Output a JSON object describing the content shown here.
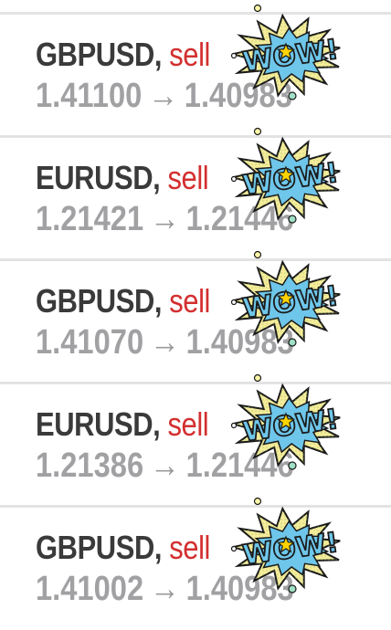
{
  "colors": {
    "pair_text": "#3a3a3a",
    "sell_red": "#d32f2f",
    "price_grey": "#a1a1a4",
    "divider": "#e3e3e3",
    "sticker_yellow": "#f5ec9a",
    "sticker_blue": "#6ec6ea",
    "sticker_star": "#ffd400"
  },
  "sticker": {
    "text": "WOW!",
    "icon": "wow-comic-sticker"
  },
  "trades": [
    {
      "pair": "GBPUSD",
      "separator": ", ",
      "direction": "sell",
      "entry_price": "1.41100",
      "arrow": "→",
      "exit_price": "1.40983"
    },
    {
      "pair": "EURUSD",
      "separator": ", ",
      "direction": "sell",
      "entry_price": "1.21421",
      "arrow": "→",
      "exit_price": "1.21446"
    },
    {
      "pair": "GBPUSD",
      "separator": ", ",
      "direction": "sell",
      "entry_price": "1.41070",
      "arrow": "→",
      "exit_price": "1.40983"
    },
    {
      "pair": "EURUSD",
      "separator": ", ",
      "direction": "sell",
      "entry_price": "1.21386",
      "arrow": "→",
      "exit_price": "1.21446"
    },
    {
      "pair": "GBPUSD",
      "separator": ", ",
      "direction": "sell",
      "entry_price": "1.41002",
      "arrow": "→",
      "exit_price": "1.40983"
    }
  ]
}
